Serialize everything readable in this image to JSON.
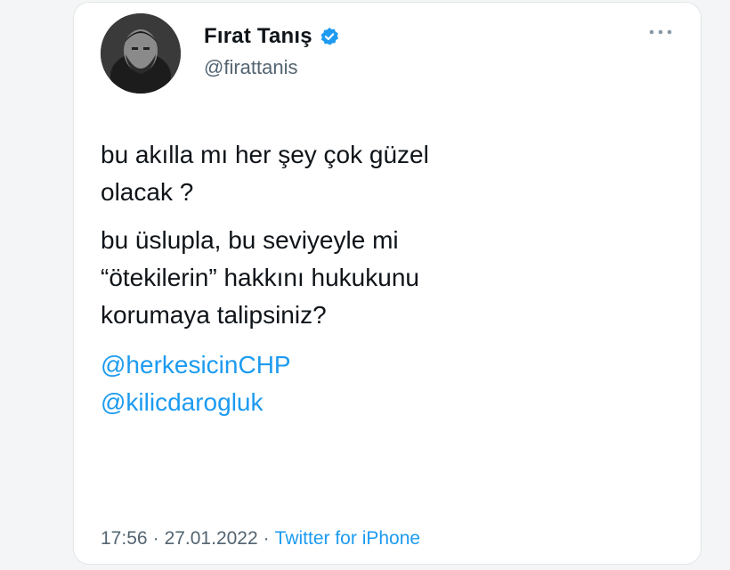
{
  "tweet": {
    "author": {
      "display_name": "Fırat Tanış",
      "handle": "@firattanis",
      "verified": true,
      "avatar_icon": "profile-photo"
    },
    "paragraphs": [
      "bu akılla mı her şey çok güzel\nolacak ?",
      "bu üslupla, bu seviyeyle mi\n“ötekilerin” hakkını hukukunu\nkorumaya talipsiniz?"
    ],
    "mentions": [
      "@herkesicinCHP",
      "@kilicdarogluk"
    ],
    "time": "17:56",
    "date": "27.01.2022",
    "separator": "·",
    "source": "Twitter for iPhone",
    "more_icon": "more-dots-icon"
  },
  "colors": {
    "text": "#0f1419",
    "secondary": "#536471",
    "link": "#1d9bf0"
  }
}
